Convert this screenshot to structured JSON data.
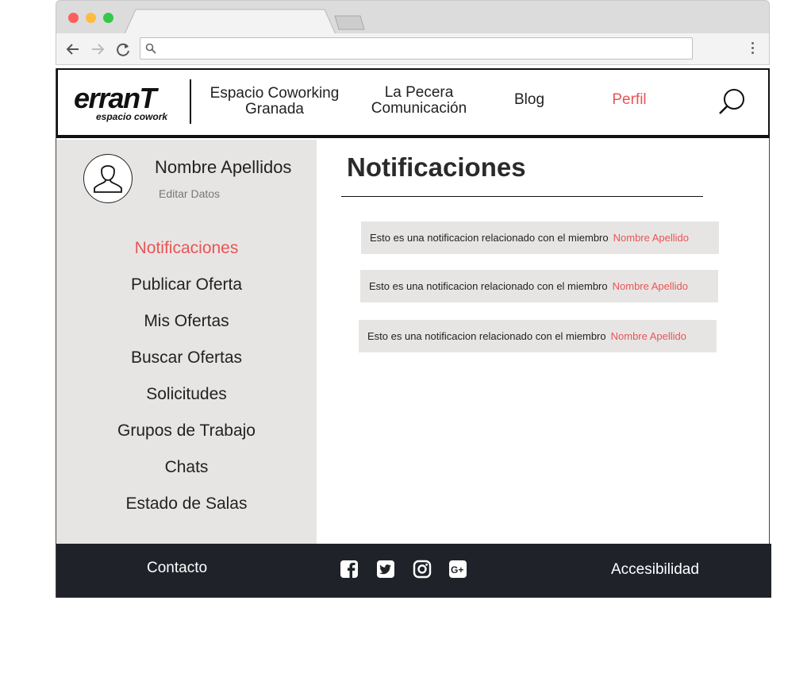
{
  "browser": {
    "address_bar": {
      "value": ""
    }
  },
  "header": {
    "logo": {
      "brand": "erranT",
      "tagline": "espacio cowork"
    },
    "nav": [
      {
        "label_line1": "Espacio Coworking",
        "label_line2": "Granada"
      },
      {
        "label_line1": "La Pecera",
        "label_line2": "Comunicación"
      },
      {
        "label_line1": "Blog",
        "label_line2": ""
      },
      {
        "label_line1": "Perfil",
        "label_line2": ""
      }
    ],
    "active_nav": "Perfil",
    "search_icon": "magnifier-icon"
  },
  "sidebar": {
    "user_name": "Nombre Apellidos",
    "edit_label": "Editar Datos",
    "menu": [
      {
        "label": "Notificaciones"
      },
      {
        "label": "Publicar Oferta"
      },
      {
        "label": "Mis Ofertas"
      },
      {
        "label": "Buscar Ofertas"
      },
      {
        "label": "Solicitudes"
      },
      {
        "label": "Grupos de Trabajo"
      },
      {
        "label": "Chats"
      },
      {
        "label": "Estado de Salas"
      }
    ],
    "active_item": "Notificaciones"
  },
  "main": {
    "title": "Notificaciones",
    "notifications": [
      {
        "text": "Esto es una notificacion relacionado con el miembro",
        "member": "Nombre Apellido"
      },
      {
        "text": "Esto es una notificacion relacionado con el miembro",
        "member": "Nombre Apellido"
      },
      {
        "text": "Esto es una notificacion relacionado con el miembro",
        "member": "Nombre Apellido"
      }
    ]
  },
  "footer": {
    "contact_label": "Contacto",
    "accessibility_label": "Accesibilidad",
    "social": [
      "facebook-icon",
      "twitter-icon",
      "instagram-icon",
      "google-plus-icon"
    ]
  },
  "colors": {
    "accent": "#e85555",
    "sidebar_bg": "#e7e5e4",
    "footer_bg": "#1f2329"
  }
}
